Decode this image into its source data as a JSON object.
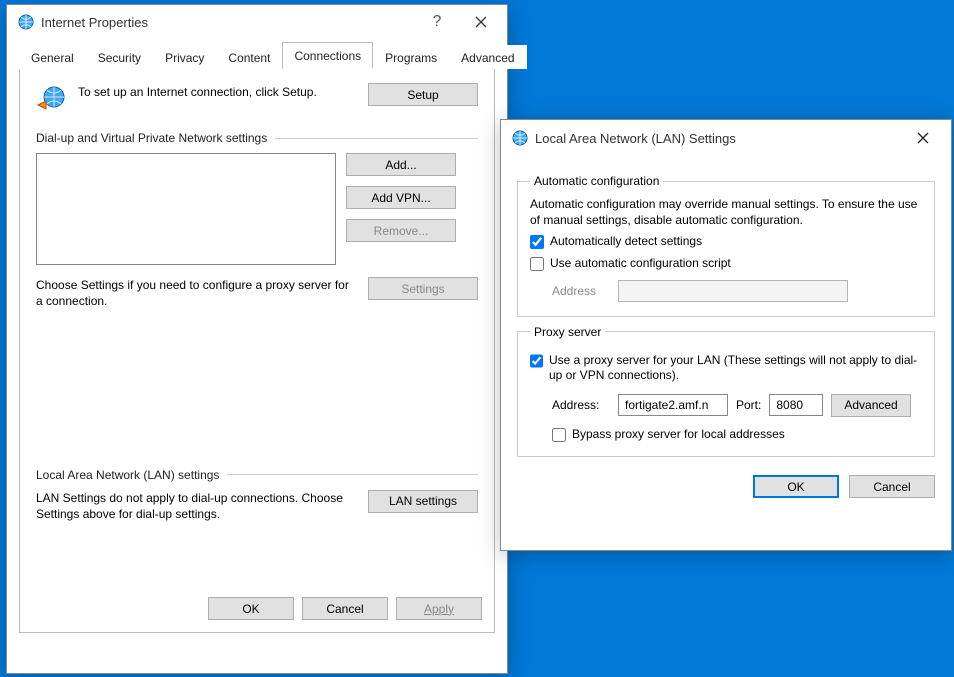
{
  "props": {
    "title": "Internet Properties",
    "tabs": [
      "General",
      "Security",
      "Privacy",
      "Content",
      "Connections",
      "Programs",
      "Advanced"
    ],
    "active_tab": 4,
    "setup_text": "To set up an Internet connection, click Setup.",
    "setup_btn": "Setup",
    "group_dialup": "Dial-up and Virtual Private Network settings",
    "btn_add": "Add...",
    "btn_addvpn": "Add VPN...",
    "btn_remove": "Remove...",
    "choose_text": "Choose Settings if you need to configure a proxy server for a connection.",
    "btn_settings": "Settings",
    "group_lan": "Local Area Network (LAN) settings",
    "lan_text": "LAN Settings do not apply to dial-up connections. Choose Settings above for dial-up settings.",
    "btn_lan": "LAN settings",
    "btn_ok": "OK",
    "btn_cancel": "Cancel",
    "btn_apply": "Apply"
  },
  "lan": {
    "title": "Local Area Network (LAN) Settings",
    "group_auto": "Automatic configuration",
    "auto_desc": "Automatic configuration may override manual settings.  To ensure the use of manual settings, disable automatic configuration.",
    "chk_auto_detect": "Automatically detect settings",
    "chk_auto_detect_checked": true,
    "chk_auto_script": "Use automatic configuration script",
    "chk_auto_script_checked": false,
    "addr_label": "Address",
    "addr_value": "",
    "group_proxy": "Proxy server",
    "chk_proxy": "Use a proxy server for your LAN (These settings will not apply to dial-up or VPN connections).",
    "chk_proxy_checked": true,
    "paddr_label": "Address:",
    "paddr_value": "fortigate2.amf.n",
    "pport_label": "Port:",
    "pport_value": "8080",
    "btn_adv": "Advanced",
    "chk_bypass": "Bypass proxy server for local addresses",
    "chk_bypass_checked": false,
    "btn_ok": "OK",
    "btn_cancel": "Cancel"
  }
}
